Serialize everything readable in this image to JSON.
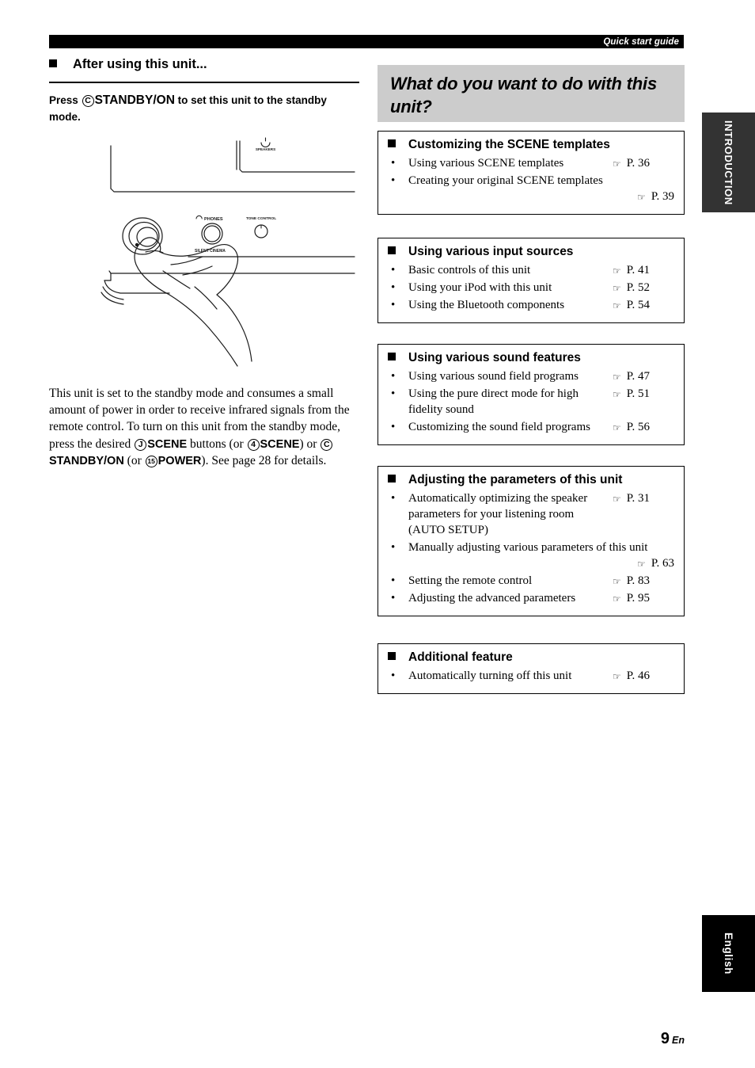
{
  "header": {
    "running_title": "Quick start guide"
  },
  "side_tabs": {
    "top": "INTRODUCTION",
    "bottom": "English"
  },
  "left": {
    "section_heading": "After using this unit...",
    "lead_press": "Press",
    "lead_marker_c": "C",
    "lead_standby": "STANDBY/ON",
    "lead_rest": "to set this unit to the standby mode.",
    "illustration": {
      "label_speakers": "SPEAKERS",
      "label_phones": "PHONES",
      "label_silent_cinema": "SILENT CINEMA",
      "label_tone_control": "TONE CONTROL"
    },
    "paragraph": {
      "p1": "This unit is set to the standby mode and consumes a small amount of power in order to receive infrared signals from the remote control. To turn on this unit from the standby mode, press the desired",
      "marker_j": "J",
      "scene1": "SCENE",
      "p2": "buttons (or",
      "marker_4": "4",
      "scene2": "SCENE",
      "p3": ") or",
      "marker_c": "C",
      "standby": "STANDBY/ON",
      "p4": "(or",
      "marker_15": "15",
      "power": "POWER",
      "p5": "). See page 28 for details."
    }
  },
  "right": {
    "title": "What do you want to do with this unit?",
    "page_icon": "☞",
    "cards": [
      {
        "title": "Customizing the SCENE templates",
        "entries": [
          {
            "bullet": "•",
            "text": "Using various SCENE templates",
            "page": "P. 36",
            "stacked": false
          },
          {
            "bullet": "•",
            "text": "Creating your original SCENE templates",
            "page": "P. 39",
            "stacked": true
          }
        ]
      },
      {
        "title": "Using various input sources",
        "entries": [
          {
            "bullet": "•",
            "text": "Basic controls of this unit",
            "page": "P. 41",
            "stacked": false
          },
          {
            "bullet": "•",
            "text": "Using your iPod with this unit",
            "page": "P. 52",
            "stacked": false
          },
          {
            "bullet": "•",
            "text": "Using the Bluetooth components",
            "page": "P. 54",
            "stacked": false
          }
        ]
      },
      {
        "title": "Using various sound features",
        "entries": [
          {
            "bullet": "•",
            "text": "Using various sound field programs",
            "page": "P. 47",
            "stacked": false
          },
          {
            "bullet": "•",
            "text": "Using the pure direct mode for high fidelity sound",
            "page": "P. 51",
            "stacked": false
          },
          {
            "bullet": "•",
            "text": "Customizing the sound field programs",
            "page": "P. 56",
            "stacked": false
          }
        ]
      },
      {
        "title": "Adjusting the parameters of this unit",
        "entries": [
          {
            "bullet": "•",
            "text": "Automatically optimizing the speaker parameters for your listening room (AUTO SETUP)",
            "page": "P. 31",
            "stacked": false
          },
          {
            "bullet": "•",
            "text": "Manually adjusting various parameters of this unit",
            "page": "P. 63",
            "stacked": true
          },
          {
            "bullet": "•",
            "text": "Setting the remote control",
            "page": "P. 83",
            "stacked": false
          },
          {
            "bullet": "•",
            "text": "Adjusting the advanced parameters",
            "page": "P. 95",
            "stacked": false
          }
        ]
      },
      {
        "title": "Additional feature",
        "entries": [
          {
            "bullet": "•",
            "text": "Automatically turning off this unit",
            "page": "P. 46",
            "stacked": false
          }
        ]
      }
    ]
  },
  "footer": {
    "page_number": "9",
    "page_suffix": "En"
  }
}
